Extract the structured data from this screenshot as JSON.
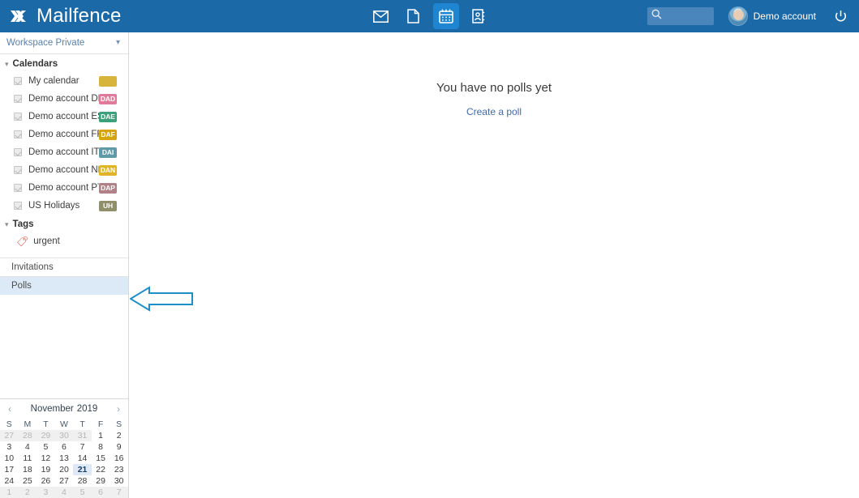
{
  "header": {
    "brand": "Mailfence",
    "brand_icon": "mailfence-logo-icon",
    "apps": [
      {
        "name": "messages",
        "icon": "envelope-icon",
        "active": false
      },
      {
        "name": "documents",
        "icon": "document-icon",
        "active": false
      },
      {
        "name": "calendar",
        "icon": "calendar-icon",
        "active": true
      },
      {
        "name": "contacts",
        "icon": "contacts-icon",
        "active": false
      }
    ],
    "search": {
      "value": "",
      "placeholder": "",
      "icon": "search-icon"
    },
    "account_name": "Demo account",
    "avatar_icon": "user-avatar",
    "logout_icon": "power-icon",
    "bar_color": "#1c69a8",
    "active_app_color": "#1e86d0"
  },
  "sidebar": {
    "workspace": {
      "label": "Workspace Private",
      "chevron": "chevron-down-icon"
    },
    "calendars_section": {
      "label": "Calendars",
      "expanded": true,
      "chevron": "chevron-down-icon"
    },
    "calendars": [
      {
        "name": "My calendar",
        "badge": "",
        "color": "#d9b43c",
        "checked": true
      },
      {
        "name": "Demo account DE",
        "badge": "DAD",
        "color": "#e07a9b",
        "checked": true
      },
      {
        "name": "Demo account ES",
        "badge": "DAE",
        "color": "#3f9e7c",
        "checked": true
      },
      {
        "name": "Demo account FR",
        "badge": "DAF",
        "color": "#d4a411",
        "checked": true
      },
      {
        "name": "Demo account IT",
        "badge": "DAI",
        "color": "#5e9aa8",
        "checked": true
      },
      {
        "name": "Demo account NL",
        "badge": "DAN",
        "color": "#e0b423",
        "checked": true
      },
      {
        "name": "Demo account PT",
        "badge": "DAP",
        "color": "#b08288",
        "checked": true
      },
      {
        "name": "US Holidays",
        "badge": "UH",
        "color": "#8f8f6a",
        "checked": true
      }
    ],
    "tags_section": {
      "label": "Tags",
      "expanded": true,
      "chevron": "chevron-down-icon"
    },
    "tags": [
      {
        "name": "urgent",
        "icon": "tag-icon",
        "color": "#d93b23"
      }
    ],
    "nav": [
      {
        "label": "Invitations",
        "selected": false
      },
      {
        "label": "Polls",
        "selected": true
      }
    ],
    "selected_color": "#dceaf7"
  },
  "mini_calendar": {
    "prev_icon": "chevron-left-icon",
    "next_icon": "chevron-right-icon",
    "month": "November",
    "year": "2019",
    "weekday_headers": [
      "S",
      "M",
      "T",
      "W",
      "T",
      "F",
      "S"
    ],
    "today": 21,
    "weeks": [
      [
        {
          "d": "27",
          "out": true
        },
        {
          "d": "28",
          "out": true
        },
        {
          "d": "29",
          "out": true
        },
        {
          "d": "30",
          "out": true
        },
        {
          "d": "31",
          "out": true
        },
        {
          "d": "1",
          "out": false
        },
        {
          "d": "2",
          "out": false
        }
      ],
      [
        {
          "d": "3",
          "out": false
        },
        {
          "d": "4",
          "out": false
        },
        {
          "d": "5",
          "out": false
        },
        {
          "d": "6",
          "out": false
        },
        {
          "d": "7",
          "out": false
        },
        {
          "d": "8",
          "out": false
        },
        {
          "d": "9",
          "out": false
        }
      ],
      [
        {
          "d": "10",
          "out": false
        },
        {
          "d": "11",
          "out": false
        },
        {
          "d": "12",
          "out": false
        },
        {
          "d": "13",
          "out": false
        },
        {
          "d": "14",
          "out": false
        },
        {
          "d": "15",
          "out": false
        },
        {
          "d": "16",
          "out": false
        }
      ],
      [
        {
          "d": "17",
          "out": false
        },
        {
          "d": "18",
          "out": false
        },
        {
          "d": "19",
          "out": false
        },
        {
          "d": "20",
          "out": false
        },
        {
          "d": "21",
          "out": false,
          "today": true
        },
        {
          "d": "22",
          "out": false
        },
        {
          "d": "23",
          "out": false
        }
      ],
      [
        {
          "d": "24",
          "out": false
        },
        {
          "d": "25",
          "out": false
        },
        {
          "d": "26",
          "out": false
        },
        {
          "d": "27",
          "out": false
        },
        {
          "d": "28",
          "out": false
        },
        {
          "d": "29",
          "out": false
        },
        {
          "d": "30",
          "out": false
        }
      ],
      [
        {
          "d": "1",
          "out": true
        },
        {
          "d": "2",
          "out": true
        },
        {
          "d": "3",
          "out": true
        },
        {
          "d": "4",
          "out": true
        },
        {
          "d": "5",
          "out": true
        },
        {
          "d": "6",
          "out": true
        },
        {
          "d": "7",
          "out": true
        }
      ]
    ]
  },
  "main": {
    "empty_title": "You have no polls yet",
    "create_link": "Create a poll"
  },
  "annotation": {
    "arrow_icon": "arrow-left-outline",
    "color": "#1f8fc9",
    "points_to": "Polls"
  }
}
